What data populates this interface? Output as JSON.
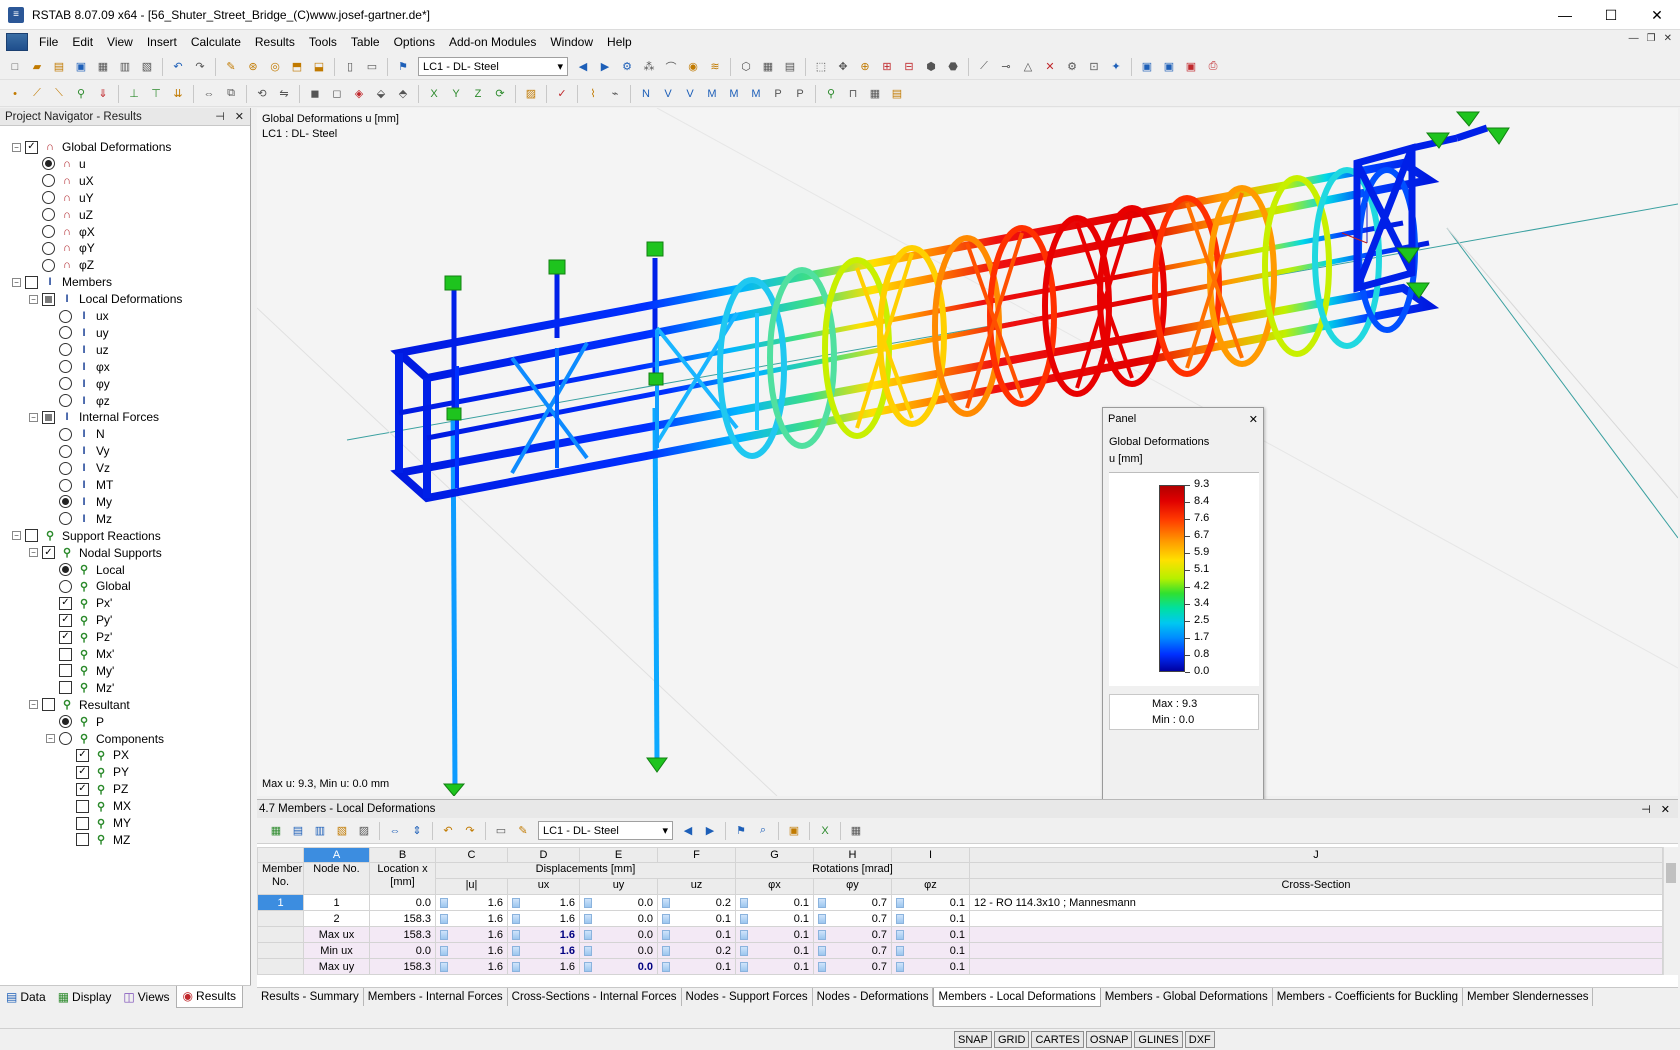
{
  "window": {
    "title": "RSTAB 8.07.09 x64 - [56_Shuter_Street_Bridge_(C)www.josef-gartner.de*]",
    "minimize": "—",
    "maximize": "☐",
    "close": "✕"
  },
  "menu": [
    "File",
    "Edit",
    "View",
    "Insert",
    "Calculate",
    "Results",
    "Tools",
    "Table",
    "Options",
    "Add-on Modules",
    "Window",
    "Help"
  ],
  "toolbar": {
    "load_case": "LC1 - DL- Steel"
  },
  "navigator": {
    "title": "Project Navigator - Results",
    "items": [
      {
        "label": "Global Deformations",
        "level": 0,
        "ctrl": "check",
        "state": "on",
        "exp": "−",
        "icon": "deform"
      },
      {
        "label": "u",
        "level": 1,
        "ctrl": "radio",
        "state": "on",
        "icon": "deform"
      },
      {
        "label": "uX",
        "level": 1,
        "ctrl": "radio",
        "state": "off",
        "icon": "deform"
      },
      {
        "label": "uY",
        "level": 1,
        "ctrl": "radio",
        "state": "off",
        "icon": "deform"
      },
      {
        "label": "uZ",
        "level": 1,
        "ctrl": "radio",
        "state": "off",
        "icon": "deform"
      },
      {
        "label": "φX",
        "level": 1,
        "ctrl": "radio",
        "state": "off",
        "icon": "deform"
      },
      {
        "label": "φY",
        "level": 1,
        "ctrl": "radio",
        "state": "off",
        "icon": "deform"
      },
      {
        "label": "φZ",
        "level": 1,
        "ctrl": "radio",
        "state": "off",
        "icon": "deform"
      },
      {
        "label": "Members",
        "level": 0,
        "ctrl": "check",
        "state": "off",
        "exp": "−",
        "icon": "member"
      },
      {
        "label": "Local Deformations",
        "level": 1,
        "ctrl": "check",
        "state": "partial",
        "exp": "−",
        "icon": "member"
      },
      {
        "label": "ux",
        "level": 2,
        "ctrl": "radio",
        "state": "off",
        "icon": "member"
      },
      {
        "label": "uy",
        "level": 2,
        "ctrl": "radio",
        "state": "off",
        "icon": "member"
      },
      {
        "label": "uz",
        "level": 2,
        "ctrl": "radio",
        "state": "off",
        "icon": "member"
      },
      {
        "label": "φx",
        "level": 2,
        "ctrl": "radio",
        "state": "off",
        "icon": "member"
      },
      {
        "label": "φy",
        "level": 2,
        "ctrl": "radio",
        "state": "off",
        "icon": "member"
      },
      {
        "label": "φz",
        "level": 2,
        "ctrl": "radio",
        "state": "off",
        "icon": "member"
      },
      {
        "label": "Internal Forces",
        "level": 1,
        "ctrl": "check",
        "state": "partial",
        "exp": "−",
        "icon": "member"
      },
      {
        "label": "N",
        "level": 2,
        "ctrl": "radio",
        "state": "off",
        "icon": "member"
      },
      {
        "label": "Vy",
        "level": 2,
        "ctrl": "radio",
        "state": "off",
        "icon": "member"
      },
      {
        "label": "Vz",
        "level": 2,
        "ctrl": "radio",
        "state": "off",
        "icon": "member"
      },
      {
        "label": "MT",
        "level": 2,
        "ctrl": "radio",
        "state": "off",
        "icon": "member"
      },
      {
        "label": "My",
        "level": 2,
        "ctrl": "radio",
        "state": "on",
        "icon": "member"
      },
      {
        "label": "Mz",
        "level": 2,
        "ctrl": "radio",
        "state": "off",
        "icon": "member"
      },
      {
        "label": "Support Reactions",
        "level": 0,
        "ctrl": "check",
        "state": "off",
        "exp": "−",
        "icon": "support"
      },
      {
        "label": "Nodal Supports",
        "level": 1,
        "ctrl": "check",
        "state": "on",
        "exp": "−",
        "icon": "support"
      },
      {
        "label": "Local",
        "level": 2,
        "ctrl": "radio",
        "state": "on",
        "icon": "support"
      },
      {
        "label": "Global",
        "level": 2,
        "ctrl": "radio",
        "state": "off",
        "icon": "support"
      },
      {
        "label": "Px'",
        "level": 2,
        "ctrl": "check",
        "state": "on",
        "icon": "support"
      },
      {
        "label": "Py'",
        "level": 2,
        "ctrl": "check",
        "state": "on",
        "icon": "support"
      },
      {
        "label": "Pz'",
        "level": 2,
        "ctrl": "check",
        "state": "on",
        "icon": "support"
      },
      {
        "label": "Mx'",
        "level": 2,
        "ctrl": "check",
        "state": "off",
        "icon": "support"
      },
      {
        "label": "My'",
        "level": 2,
        "ctrl": "check",
        "state": "off",
        "icon": "support"
      },
      {
        "label": "Mz'",
        "level": 2,
        "ctrl": "check",
        "state": "off",
        "icon": "support"
      },
      {
        "label": "Resultant",
        "level": 1,
        "ctrl": "check",
        "state": "off",
        "exp": "−",
        "icon": "support"
      },
      {
        "label": "P",
        "level": 2,
        "ctrl": "radio",
        "state": "on",
        "icon": "support"
      },
      {
        "label": "Components",
        "level": 2,
        "ctrl": "radio",
        "state": "off",
        "exp": "−",
        "icon": "support"
      },
      {
        "label": "PX",
        "level": 3,
        "ctrl": "check",
        "state": "on",
        "icon": "support"
      },
      {
        "label": "PY",
        "level": 3,
        "ctrl": "check",
        "state": "on",
        "icon": "support"
      },
      {
        "label": "PZ",
        "level": 3,
        "ctrl": "check",
        "state": "on",
        "icon": "support"
      },
      {
        "label": "MX",
        "level": 3,
        "ctrl": "check",
        "state": "off",
        "icon": "support"
      },
      {
        "label": "MY",
        "level": 3,
        "ctrl": "check",
        "state": "off",
        "icon": "support"
      },
      {
        "label": "MZ",
        "level": 3,
        "ctrl": "check",
        "state": "off",
        "icon": "support"
      }
    ],
    "tabs": [
      "Data",
      "Display",
      "Views",
      "Results"
    ]
  },
  "viewport": {
    "title": "Global Deformations u [mm]",
    "subtitle": "LC1 : DL- Steel",
    "footer": "Max u: 9.3, Min u: 0.0 mm"
  },
  "panel": {
    "title": "Panel",
    "heading": "Global Deformations",
    "unit": "u [mm]",
    "legend": [
      "9.3",
      "8.4",
      "7.6",
      "6.7",
      "5.9",
      "5.1",
      "4.2",
      "3.4",
      "2.5",
      "1.7",
      "0.8",
      "0.0"
    ],
    "max_label": "Max  :",
    "max_value": "9.3",
    "min_label": "Min  :",
    "min_value": "0.0"
  },
  "table": {
    "title": "4.7 Members - Local Deformations",
    "load_case": "LC1 - DL- Steel",
    "col_letters": [
      "A",
      "B",
      "C",
      "D",
      "E",
      "F",
      "G",
      "H",
      "I",
      "J"
    ],
    "group_displacements": "Displacements [mm]",
    "group_rotations": "Rotations [mrad]",
    "headers": {
      "member": "Member No.",
      "node": "Node No.",
      "location": "Location x [mm]",
      "abs_u": "|u|",
      "ux": "ux",
      "uy": "uy",
      "uz": "uz",
      "phix": "φx",
      "phiy": "φy",
      "phiz": "φz",
      "cross_section": "Cross-Section"
    },
    "rows": [
      {
        "member": "1",
        "node": "1",
        "x": "0.0",
        "u": "1.6",
        "ux": "1.6",
        "uy": "0.0",
        "uz": "0.2",
        "px": "0.1",
        "py": "0.7",
        "pz": "0.1",
        "cs": "12 - RO 114.3x10 ; Mannesmann",
        "summary": false,
        "bold": ""
      },
      {
        "member": "",
        "node": "2",
        "x": "158.3",
        "u": "1.6",
        "ux": "1.6",
        "uy": "0.0",
        "uz": "0.1",
        "px": "0.1",
        "py": "0.7",
        "pz": "0.1",
        "cs": "",
        "summary": false,
        "bold": ""
      },
      {
        "member": "",
        "node": "Max ux",
        "x": "158.3",
        "u": "1.6",
        "ux": "1.6",
        "uy": "0.0",
        "uz": "0.1",
        "px": "0.1",
        "py": "0.7",
        "pz": "0.1",
        "cs": "",
        "summary": true,
        "bold": "ux"
      },
      {
        "member": "",
        "node": "Min ux",
        "x": "0.0",
        "u": "1.6",
        "ux": "1.6",
        "uy": "0.0",
        "uz": "0.2",
        "px": "0.1",
        "py": "0.7",
        "pz": "0.1",
        "cs": "",
        "summary": true,
        "bold": "ux"
      },
      {
        "member": "",
        "node": "Max uy",
        "x": "158.3",
        "u": "1.6",
        "ux": "1.6",
        "uy": "0.0",
        "uz": "0.1",
        "px": "0.1",
        "py": "0.7",
        "pz": "0.1",
        "cs": "",
        "summary": true,
        "bold": "uy"
      }
    ],
    "tabs": [
      "Results - Summary",
      "Members - Internal Forces",
      "Cross-Sections - Internal Forces",
      "Nodes - Support Forces",
      "Nodes - Deformations",
      "Members - Local Deformations",
      "Members - Global Deformations",
      "Members - Coefficients for Buckling",
      "Member Slendernesses"
    ],
    "active_tab": 5
  },
  "statusbar": [
    "SNAP",
    "GRID",
    "CARTES",
    "OSNAP",
    "GLINES",
    "DXF"
  ]
}
